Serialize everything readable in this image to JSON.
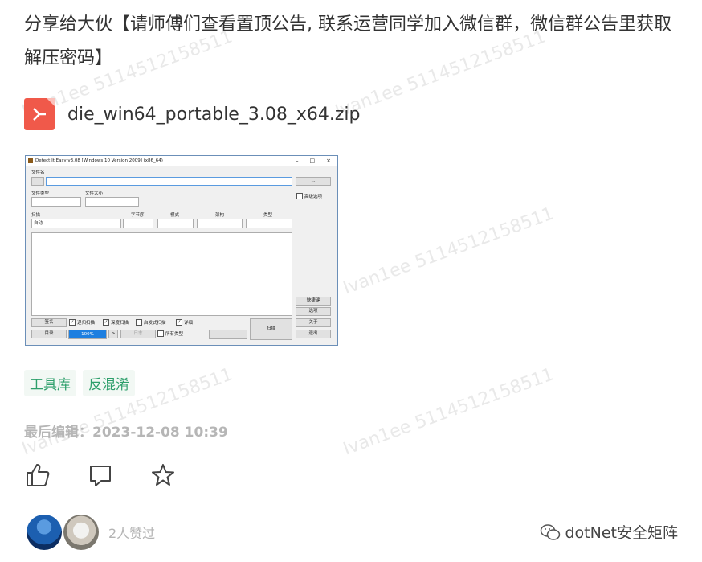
{
  "intro_text": "分享给大伙【请师傅们查看置顶公告, 联系运营同学加入微信群，微信群公告里获取解压密码】",
  "watermark": "Ivan1ee 5114512158511",
  "attachment": {
    "filename": "die_win64_portable_3.08_x64.zip",
    "icon": "pdf-like-file-icon"
  },
  "app_window": {
    "title": "Detect It Easy v3.08 [Windows 10 Version 2009] (x86_64)",
    "window_controls": [
      "–",
      "□",
      "×"
    ],
    "file_name_label": "文件名",
    "browse_button": "...",
    "file_type_label": "文件类型",
    "file_size_label": "文件大小",
    "advanced_label": "高级选项",
    "scan_label": "扫描",
    "scan_mode": "自动",
    "columns": [
      "字节序",
      "模式",
      "架构",
      "类型"
    ],
    "side_buttons": [
      "快捷键",
      "选项",
      "关于",
      "退出"
    ],
    "signature_button": "签名",
    "recursive_scan": "递归扫描",
    "deep_scan": "深度扫描",
    "heuristic_scan": "启发式扫描",
    "verbose": "详细",
    "dir_button": "目录",
    "progress_text": "100%",
    "progress": 1.0,
    "arrow_button": ">",
    "log_button": "日志",
    "all_types": "所有类型",
    "scan_button": "扫描"
  },
  "tags": [
    "工具库",
    "反混淆"
  ],
  "edit_info": "最后编辑：2023-12-08 10:39",
  "actions": [
    "thumbs-up-icon",
    "comment-icon",
    "star-icon"
  ],
  "likes_text": "2人赞过",
  "brand_name": "dotNet安全矩阵"
}
